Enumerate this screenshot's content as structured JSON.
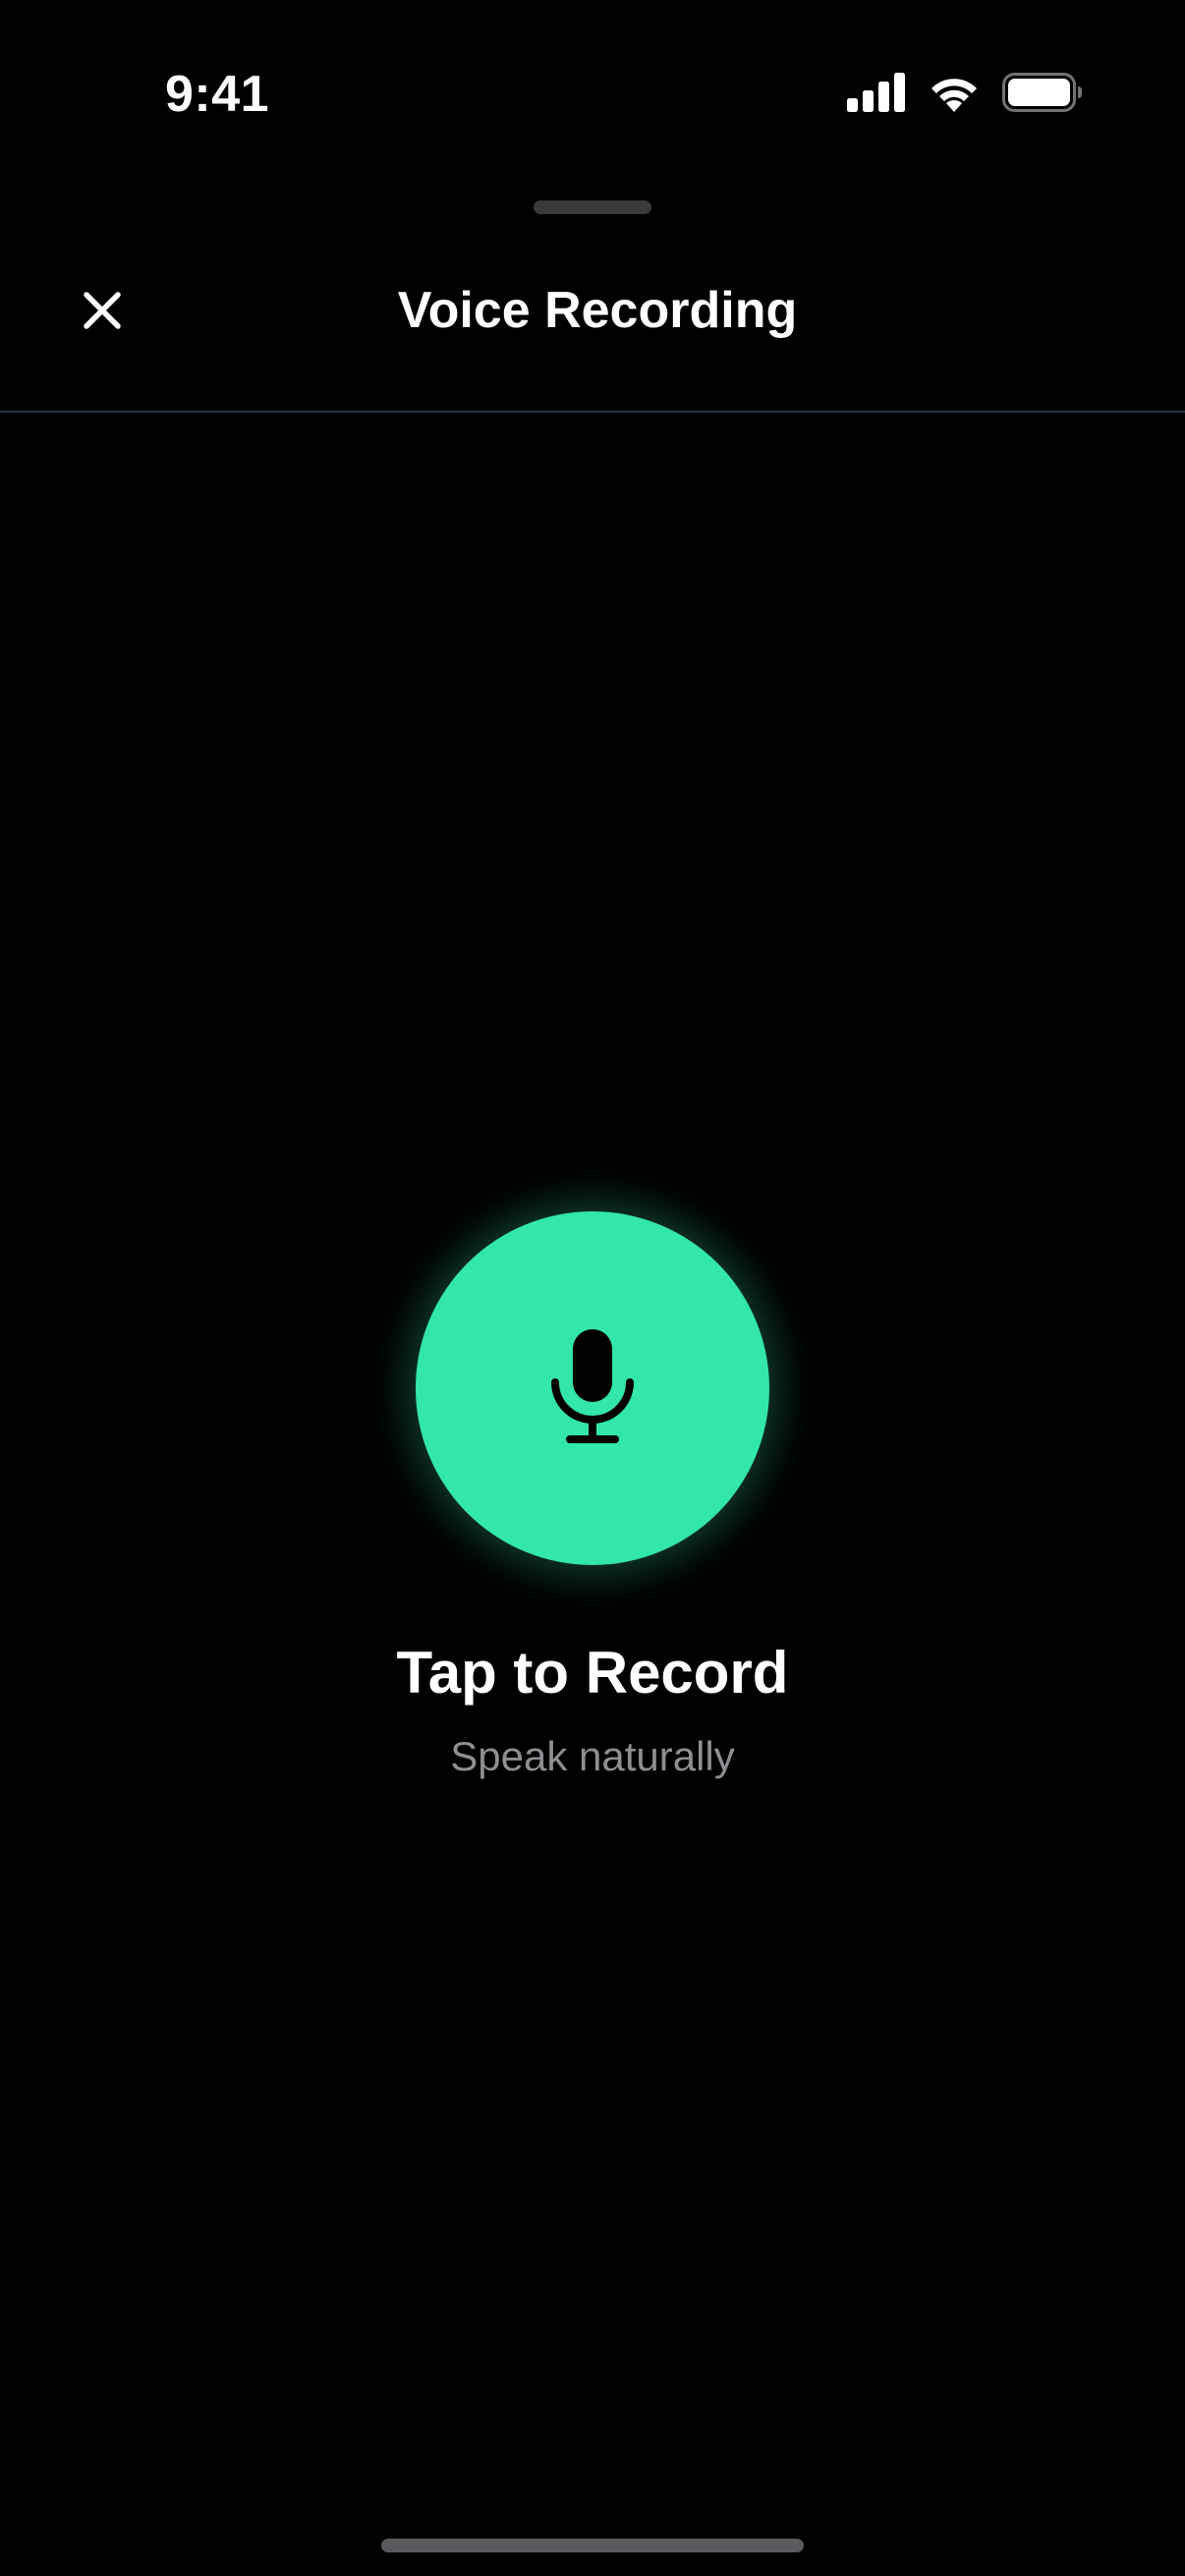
{
  "status_bar": {
    "time": "9:41",
    "icons": [
      "signal-icon",
      "wifi-icon",
      "battery-icon"
    ]
  },
  "header": {
    "title": "Voice Recording",
    "close_icon": "close-icon"
  },
  "recorder": {
    "button_icon": "microphone-icon",
    "title": "Tap to Record",
    "subtitle": "Speak naturally"
  },
  "colors": {
    "background": "#000000",
    "accent": "#33e6aa",
    "subtitle": "#8e8e93",
    "divider": "#2c3540"
  }
}
